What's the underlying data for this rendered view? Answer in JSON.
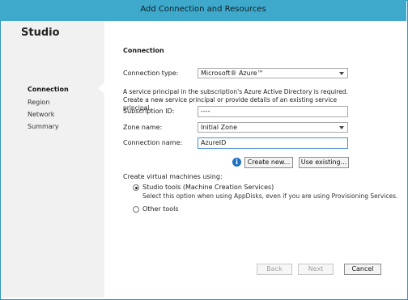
{
  "window": {
    "title": "Add Connection and Resources"
  },
  "sidebar": {
    "title": "Studio",
    "items": [
      {
        "label": "Connection",
        "active": true
      },
      {
        "label": "Region",
        "active": false
      },
      {
        "label": "Network",
        "active": false
      },
      {
        "label": "Summary",
        "active": false
      }
    ]
  },
  "main": {
    "heading": "Connection",
    "connection_type": {
      "label": "Connection type:",
      "value": "Microsoft® Azure™"
    },
    "description": "A service principal in the subscription's Azure Active Directory is required. Create a new service principal or provide details of an existing service principal.",
    "subscription": {
      "label": "Subscription ID:",
      "value": "----"
    },
    "zone": {
      "label": "Zone name:",
      "value": "Initial Zone"
    },
    "connection_name": {
      "label": "Connection name:",
      "value": "AzureID"
    },
    "buttons": {
      "create_new": "Create new...",
      "use_existing": "Use existing..."
    },
    "vm_section": {
      "heading": "Create virtual machines using:",
      "options": [
        {
          "label": "Studio tools (Machine Creation Services)",
          "checked": true,
          "subtext": "Select this option when using AppDisks, even if you are using Provisioning Services."
        },
        {
          "label": "Other tools",
          "checked": false
        }
      ]
    }
  },
  "footer": {
    "back": "Back",
    "next": "Next",
    "cancel": "Cancel"
  },
  "colors": {
    "titlebar": "#3fa9cc",
    "info_icon": "#1f6fbf"
  }
}
